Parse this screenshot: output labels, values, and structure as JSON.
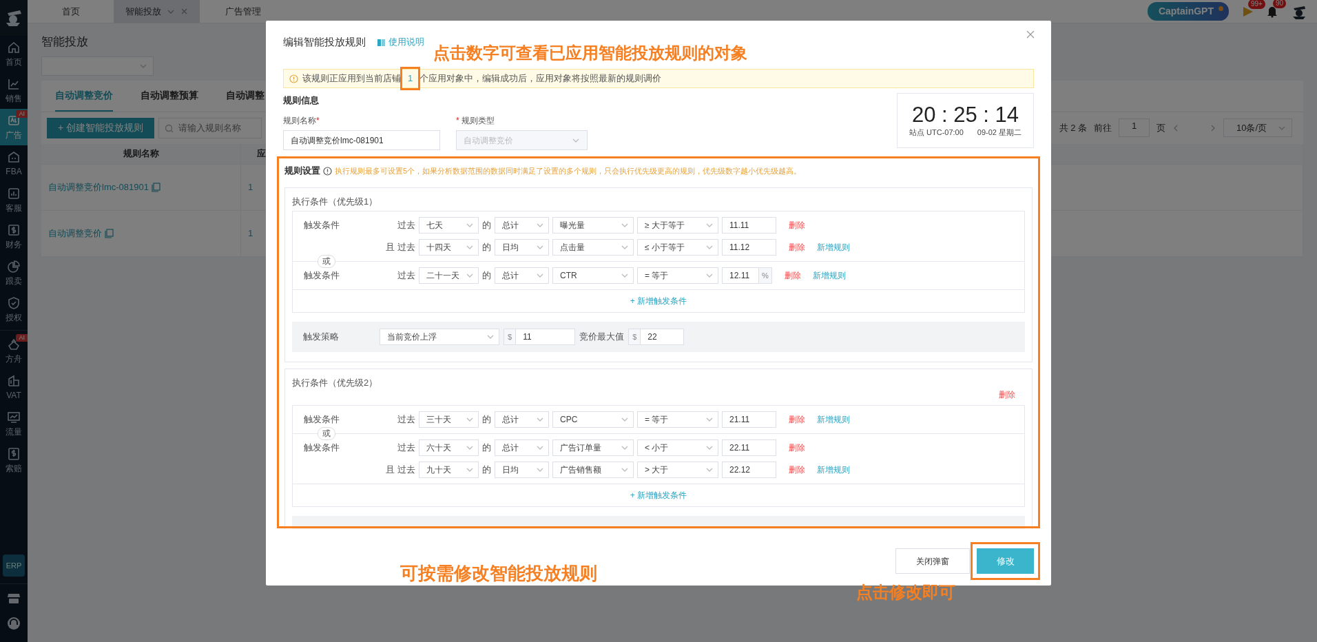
{
  "sidebar": {
    "groups": [
      {
        "items": [
          {
            "kind": "home",
            "label": "首页",
            "selected": false
          },
          {
            "kind": "sales",
            "label": "销售",
            "selected": false
          },
          {
            "kind": "ad",
            "label": "广告",
            "selected": true,
            "badge": "AI"
          },
          {
            "kind": "fba",
            "label": "FBA",
            "selected": false
          },
          {
            "kind": "service",
            "label": "客服",
            "selected": false
          },
          {
            "kind": "finance",
            "label": "财务",
            "selected": false
          },
          {
            "kind": "pie",
            "label": "跟卖",
            "selected": false
          },
          {
            "kind": "shield",
            "label": "授权",
            "selected": false
          }
        ]
      },
      {
        "items": [
          {
            "kind": "ark",
            "label": "方舟",
            "selected": false,
            "badge": "AI"
          },
          {
            "kind": "vat",
            "label": "VAT",
            "selected": false
          },
          {
            "kind": "traffic",
            "label": "流量",
            "selected": false
          },
          {
            "kind": "claim",
            "label": "索赔",
            "selected": false
          }
        ]
      }
    ],
    "erp": "ERP"
  },
  "top_tabs": [
    {
      "label": "首页",
      "selected": false
    },
    {
      "label": "智能投放",
      "selected": true,
      "closable": true
    },
    {
      "label": "广告管理",
      "selected": false
    }
  ],
  "header_actions": {
    "assistant": "CaptainGPT",
    "flag_badge": "99+",
    "bell_badge": "90"
  },
  "page": {
    "title": "智能投放",
    "tabs": [
      {
        "label": "自动调整竞价",
        "selected": true
      },
      {
        "label": "自动调整预算",
        "selected": false
      },
      {
        "label": "自动调整",
        "selected": false
      }
    ],
    "create_button": "+ 创建智能投放规则",
    "search": {
      "placeholder": "请输入规则名称"
    },
    "pagination": {
      "total": "共 2 条",
      "goto": "前往",
      "page": "1",
      "page_unit": "页",
      "page_size": "10条/页"
    },
    "table": {
      "columns": [
        "规则名称",
        "应"
      ],
      "rows": [
        {
          "name": "自动调整竞价lmc-081901",
          "count": "1"
        },
        {
          "name": "自动调整竞价",
          "count": "1"
        }
      ]
    }
  },
  "dialog": {
    "title": "编辑智能投放规则",
    "help_link": "使用说明",
    "alert": {
      "before": "该规则正应用到当前店铺",
      "count": "1",
      "after": "个应用对象中，编辑成功后，应用对象将按照最新的规则调价"
    },
    "info": {
      "heading": "规则信息",
      "name_field": {
        "label": "规则名称",
        "mark_after": "*",
        "value": "自动调整竞价lmc-081901"
      },
      "type_field": {
        "label": "规则类型",
        "mark_before": "*",
        "value": "自动调整竞价",
        "disabled": true
      }
    },
    "clock": {
      "time": "20 : 25 : 14",
      "zone": "站点 UTC-07:00",
      "date": "09-02 星期二"
    },
    "settings": {
      "heading": "规则设置",
      "hint": "执行规则最多可设置5个，如果分析数据范围的数据同时满足了设置的多个规则，只会执行优先级更高的规则，优先级数字越小优先级越高。",
      "priorities": [
        {
          "title": "执行条件（优先级1）",
          "or_label": "或",
          "add_trigger": "+ 新增触发条件",
          "groups": [
            {
              "label": "触发条件",
              "conditions": [
                {
                  "past": "过去",
                  "period": "七天",
                  "of": "的",
                  "agg": "总计",
                  "metric": "曝光量",
                  "op": "≥ 大于等于",
                  "value": "11.11",
                  "delete": "删除"
                },
                {
                  "prefix": "且",
                  "past": "过去",
                  "period": "十四天",
                  "of": "的",
                  "agg": "日均",
                  "metric": "点击量",
                  "op": "≤ 小于等于",
                  "value": "11.12",
                  "delete": "删除",
                  "add": "新增规则"
                }
              ]
            },
            {
              "label": "触发条件",
              "conditions": [
                {
                  "past": "过去",
                  "period": "二十一天",
                  "of": "的",
                  "agg": "总计",
                  "metric": "CTR",
                  "op": "= 等于",
                  "value": "12.11",
                  "unit": "%",
                  "delete": "删除",
                  "add": "新增规则"
                }
              ]
            }
          ],
          "strategy": {
            "label": "触发策略",
            "type": "当前竞价上浮",
            "currency": "$",
            "value": "11",
            "max_label": "竞价最大值",
            "max_currency": "$",
            "max_value": "22"
          }
        },
        {
          "title": "执行条件（优先级2）",
          "delete": "删除",
          "or_label": "或",
          "add_trigger": "+ 新增触发条件",
          "groups": [
            {
              "label": "触发条件",
              "conditions": [
                {
                  "past": "过去",
                  "period": "三十天",
                  "of": "的",
                  "agg": "总计",
                  "metric": "CPC",
                  "op": "= 等于",
                  "value": "21.11",
                  "delete": "删除",
                  "add": "新增规则"
                }
              ]
            },
            {
              "label": "触发条件",
              "conditions": [
                {
                  "past": "过去",
                  "period": "六十天",
                  "of": "的",
                  "agg": "总计",
                  "metric": "广告订单量",
                  "op": "< 小于",
                  "value": "22.11",
                  "delete": "删除"
                },
                {
                  "prefix": "且",
                  "past": "过去",
                  "period": "九十天",
                  "of": "的",
                  "agg": "日均",
                  "metric": "广告销售额",
                  "op": "> 大于",
                  "value": "22.12",
                  "delete": "删除",
                  "add": "新增规则"
                }
              ]
            }
          ]
        }
      ]
    },
    "buttons": [
      {
        "label": "关闭弹窗",
        "kind": "secondary"
      },
      {
        "label": "修改",
        "kind": "primary"
      }
    ]
  },
  "annotations": [
    {
      "kind": "text",
      "text": "点击数字可查看已应用智能投放规则的对象"
    },
    {
      "kind": "box"
    },
    {
      "kind": "box"
    },
    {
      "kind": "text",
      "text": "可按需修改智能投放规则"
    },
    {
      "kind": "box"
    },
    {
      "kind": "text",
      "text": "点击修改即可"
    }
  ]
}
